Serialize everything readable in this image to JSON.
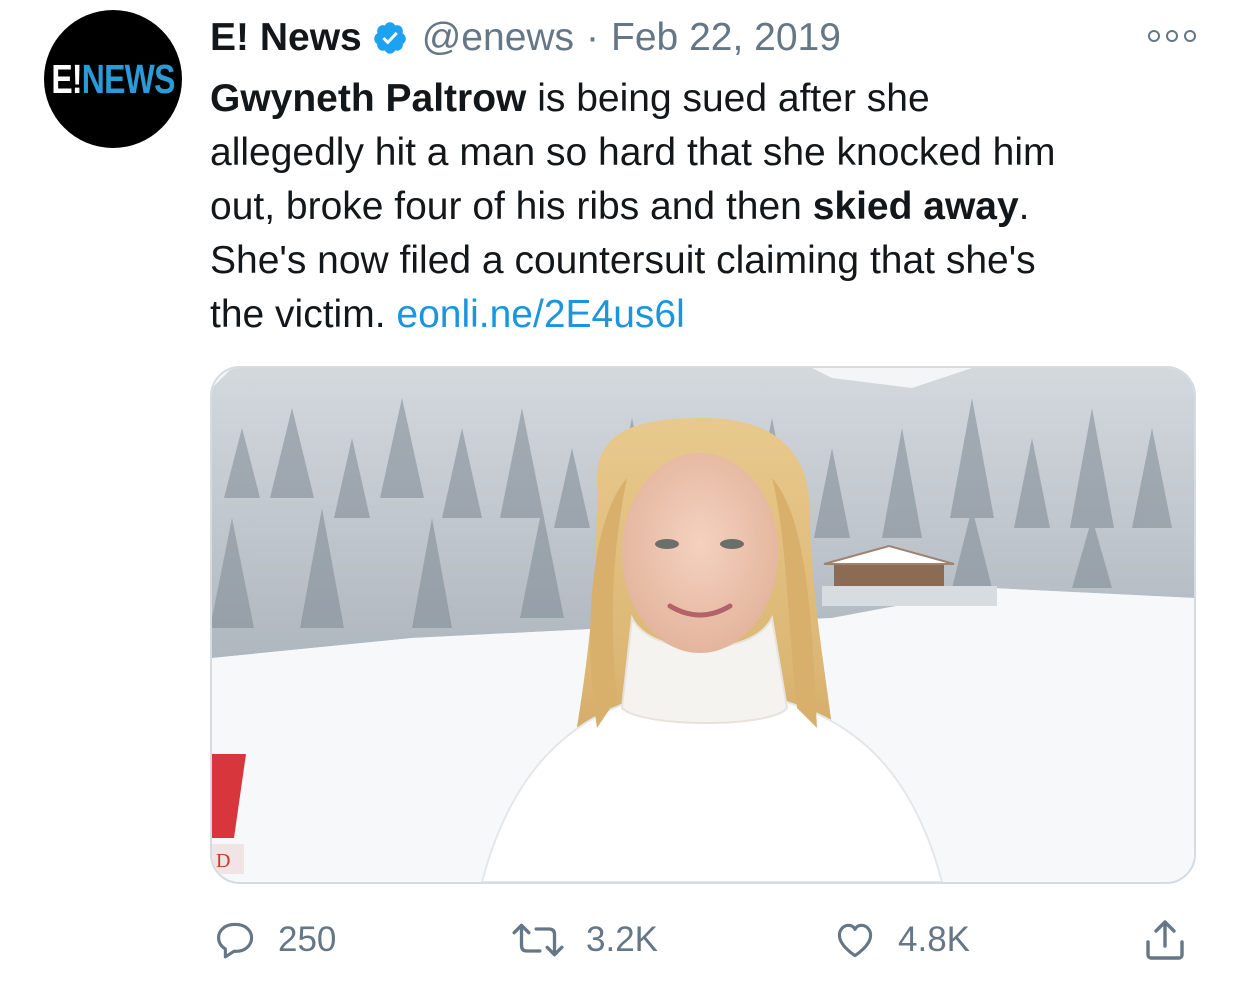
{
  "tweet": {
    "avatar": {
      "logo_part1": "E!",
      "logo_part2": "NEWS",
      "background": "#000000",
      "accent": "#2a9bd6"
    },
    "author": {
      "display_name": "E! News",
      "verified": true,
      "handle": "@enews"
    },
    "separator": "·",
    "date": "Feb 22, 2019",
    "text": {
      "line1_bold": "Gwyneth Paltrow",
      "line1_rest": " is being sued after she",
      "line2": "allegedly hit a man so hard that she knocked him",
      "line3_start": "out, broke four of his ribs and then ",
      "line3_bold": "skied away",
      "line3_end": ".",
      "line4": "She's now filed a countersuit claiming that she's",
      "line5_start": "the victim. ",
      "link": "eonli.ne/2E4us6l"
    },
    "media": {
      "description_icon": "photo",
      "partial_sign_text": "D"
    },
    "actions": {
      "replies": "250",
      "retweets": "3.2K",
      "likes": "4.8K",
      "reply_icon": "reply-icon",
      "retweet_icon": "retweet-icon",
      "like_icon": "heart-icon",
      "share_icon": "share-icon"
    },
    "colors": {
      "text": "#14171a",
      "secondary": "#657786",
      "link": "#1b95e0",
      "verified": "#1da1f2",
      "media_border": "#d4dbe1"
    }
  }
}
